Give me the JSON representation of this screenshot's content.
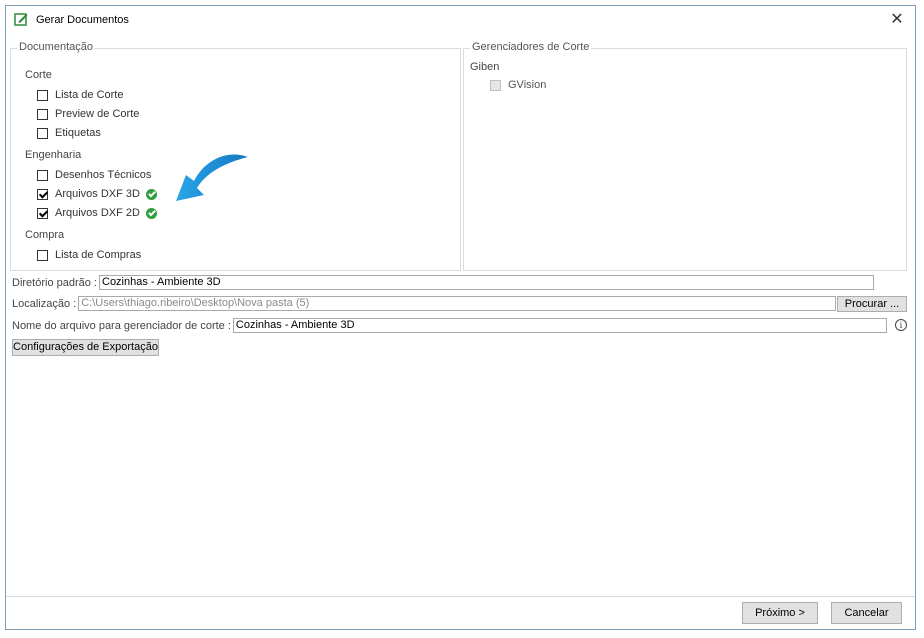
{
  "window": {
    "title": "Gerar Documentos",
    "close_glyph": "✕"
  },
  "documentation": {
    "title": "Documentação",
    "sections": [
      {
        "label": "Corte",
        "items": [
          {
            "label": "Lista de Corte",
            "checked": false
          },
          {
            "label": "Preview de Corte",
            "checked": false
          },
          {
            "label": "Etiquetas",
            "checked": false
          }
        ]
      },
      {
        "label": "Engenharia",
        "items": [
          {
            "label": "Desenhos Técnicos",
            "checked": false
          },
          {
            "label": "Arquivos DXF 3D",
            "checked": true,
            "status": "ok"
          },
          {
            "label": "Arquivos DXF 2D",
            "checked": true,
            "status": "ok"
          }
        ]
      },
      {
        "label": "Compra",
        "items": [
          {
            "label": "Lista de Compras",
            "checked": false
          }
        ]
      }
    ]
  },
  "cut_managers": {
    "title": "Gerenciadores de Corte",
    "vendor": "Giben",
    "item": {
      "label": "GVision",
      "checked": false,
      "disabled": true
    }
  },
  "fields": {
    "default_dir_label": "Diretório padrão :",
    "default_dir_value": "Cozinhas - Ambiente 3D",
    "location_label": "Localização :",
    "location_value": "C:\\Users\\thiago.ribeiro\\Desktop\\Nova pasta (5)",
    "browse_label": "Procurar ...",
    "filename_label": "Nome do arquivo para gerenciador de corte :",
    "filename_value": "Cozinhas - Ambiente 3D",
    "export_config_label": "Configurações de Exportação"
  },
  "footer": {
    "next_label": "Próximo >",
    "cancel_label": "Cancelar"
  },
  "colors": {
    "arrow": "#1e90d8",
    "ok": "#2e9e3e"
  }
}
